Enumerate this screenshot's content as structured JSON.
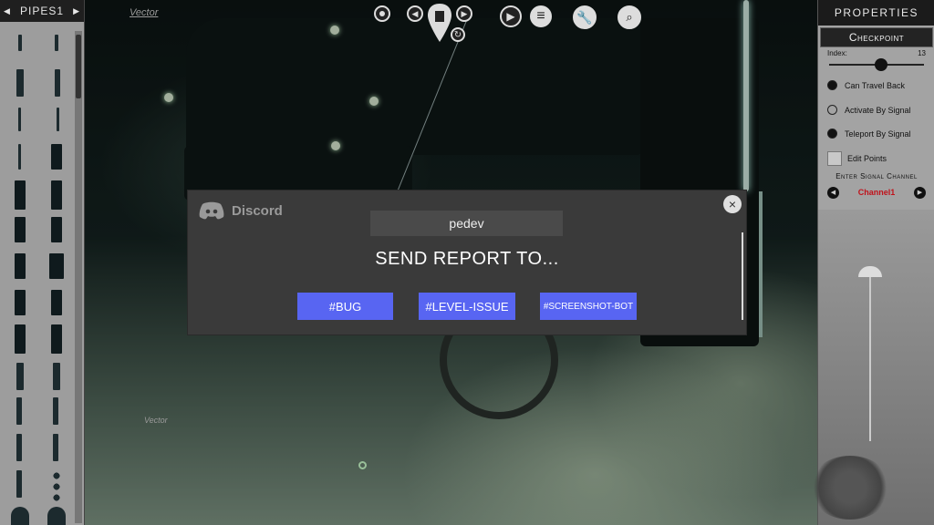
{
  "left_panel": {
    "title": "PIPES1",
    "prev": "◀",
    "next": "▶"
  },
  "canvas": {
    "label_top": "Vector",
    "label_mid": "Vector"
  },
  "toolbar": {
    "target_icon": "target-icon",
    "prev_icon": "◀",
    "next_icon": "▶",
    "play_icon": "▶",
    "menu_icon": "≡",
    "wrench_icon": "wrench-icon",
    "search_icon": "search-icon"
  },
  "properties": {
    "title": "PROPERTIES",
    "section": "Checkpoint",
    "index_label": "Index:",
    "index_value": "13",
    "index_fraction": 0.55,
    "can_travel_back": "Can Travel Back",
    "activate_by_signal": "Activate By Signal",
    "teleport_by_signal": "Teleport By Signal",
    "edit_points": "Edit Points",
    "signal_label": "Enter Signal Channel",
    "channel": "Channel1"
  },
  "dialog": {
    "brand": "Discord",
    "username": "pedev",
    "title": "SEND REPORT TO...",
    "channels": [
      "#BUG",
      "#LEVEL-ISSUE",
      "#SCREENSHOT-BOT"
    ],
    "close": "×"
  },
  "colors": {
    "discord_blurple": "#5865f2",
    "channel_red": "#c0121b"
  }
}
